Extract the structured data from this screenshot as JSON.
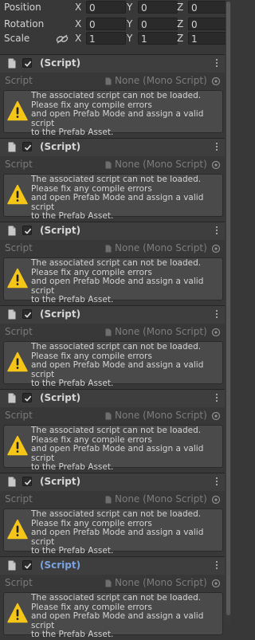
{
  "transform": {
    "rows": [
      {
        "label": "Position",
        "x": "0",
        "y": "0",
        "z": "0"
      },
      {
        "label": "Rotation",
        "x": "0",
        "y": "0",
        "z": "0"
      },
      {
        "label": "Scale",
        "x": "1",
        "y": "1",
        "z": "1"
      }
    ],
    "axes": {
      "x": "X",
      "y": "Y",
      "z": "Z"
    }
  },
  "components": [
    {
      "title": "(Script)",
      "script_label": "Script",
      "script_value": "None (Mono Script)",
      "message": "The associated script can not be loaded.\nPlease fix any compile errors\nand open Prefab Mode and assign a valid script\nto the Prefab Asset.",
      "enabled": true,
      "selected": false
    },
    {
      "title": "(Script)",
      "script_label": "Script",
      "script_value": "None (Mono Script)",
      "message": "The associated script can not be loaded.\nPlease fix any compile errors\nand open Prefab Mode and assign a valid script\nto the Prefab Asset.",
      "enabled": true,
      "selected": false
    },
    {
      "title": "(Script)",
      "script_label": "Script",
      "script_value": "None (Mono Script)",
      "message": "The associated script can not be loaded.\nPlease fix any compile errors\nand open Prefab Mode and assign a valid script\nto the Prefab Asset.",
      "enabled": true,
      "selected": false
    },
    {
      "title": "(Script)",
      "script_label": "Script",
      "script_value": "None (Mono Script)",
      "message": "The associated script can not be loaded.\nPlease fix any compile errors\nand open Prefab Mode and assign a valid script\nto the Prefab Asset.",
      "enabled": true,
      "selected": false
    },
    {
      "title": "(Script)",
      "script_label": "Script",
      "script_value": "None (Mono Script)",
      "message": "The associated script can not be loaded.\nPlease fix any compile errors\nand open Prefab Mode and assign a valid script\nto the Prefab Asset.",
      "enabled": true,
      "selected": false
    },
    {
      "title": "(Script)",
      "script_label": "Script",
      "script_value": "None (Mono Script)",
      "message": "The associated script can not be loaded.\nPlease fix any compile errors\nand open Prefab Mode and assign a valid script\nto the Prefab Asset.",
      "enabled": true,
      "selected": false
    },
    {
      "title": "(Script)",
      "script_label": "Script",
      "script_value": "None (Mono Script)",
      "message": "The associated script can not be loaded.\nPlease fix any compile errors\nand open Prefab Mode and assign a valid script\nto the Prefab Asset.",
      "enabled": true,
      "selected": true
    }
  ],
  "icons": {
    "component": "script-document-icon",
    "enabled_toggle": "checkmark-icon",
    "menu": "kebab-menu-icon",
    "script_field": "mono-script-icon",
    "object_picker": "object-picker-icon",
    "warning": "warning-triangle-icon",
    "scale_link": "chain-link-icon"
  },
  "colors": {
    "background": "#383838",
    "header": "#3e3e3e",
    "helpbox": "#4a4a4a",
    "warning": "#f5c518",
    "selected_title": "#7ba3e0"
  }
}
